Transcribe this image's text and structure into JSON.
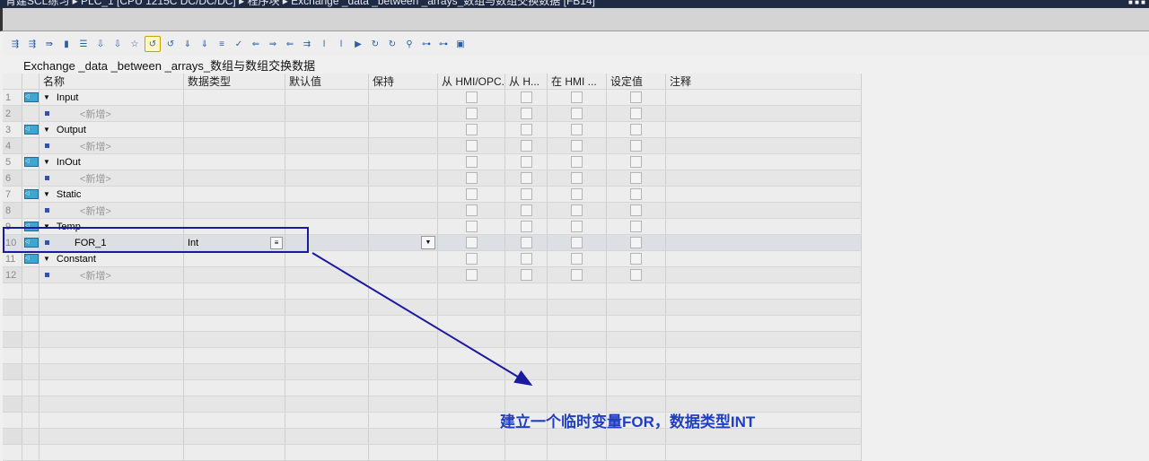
{
  "titlebar": {
    "text": "青建SCL练习 ▸ PLC_1 [CPU 1215C DC/DC/DC] ▸ 程序块 ▸ Exchange _data _between _arrays_数组与数组交换数据 [FB14]"
  },
  "block_title": "Exchange _data _between _arrays_数组与数组交换数据",
  "columns": [
    "名称",
    "数据类型",
    "默认值",
    "保持",
    "从 HMI/OPC...",
    "从 H...",
    "在 HMI ...",
    "设定值",
    "注释"
  ],
  "rows": [
    {
      "num": "1",
      "name": "Input",
      "type": "section"
    },
    {
      "num": "2",
      "name": "<新增>",
      "type": "add"
    },
    {
      "num": "3",
      "name": "Output",
      "type": "section"
    },
    {
      "num": "4",
      "name": "<新增>",
      "type": "add"
    },
    {
      "num": "5",
      "name": "InOut",
      "type": "section"
    },
    {
      "num": "6",
      "name": "<新增>",
      "type": "add"
    },
    {
      "num": "7",
      "name": "Static",
      "type": "section"
    },
    {
      "num": "8",
      "name": "<新增>",
      "type": "add"
    },
    {
      "num": "9",
      "name": "Temp",
      "type": "section"
    },
    {
      "num": "10",
      "name": "FOR_1",
      "type": "var",
      "datatype": "Int"
    },
    {
      "num": "11",
      "name": "Constant",
      "type": "section"
    },
    {
      "num": "12",
      "name": "<新增>",
      "type": "add"
    }
  ],
  "annotation": "建立一个临时变量FOR，数据类型INT",
  "colors": {
    "annotation": "#1f3fc0",
    "highlight": "#1a1a9e"
  }
}
